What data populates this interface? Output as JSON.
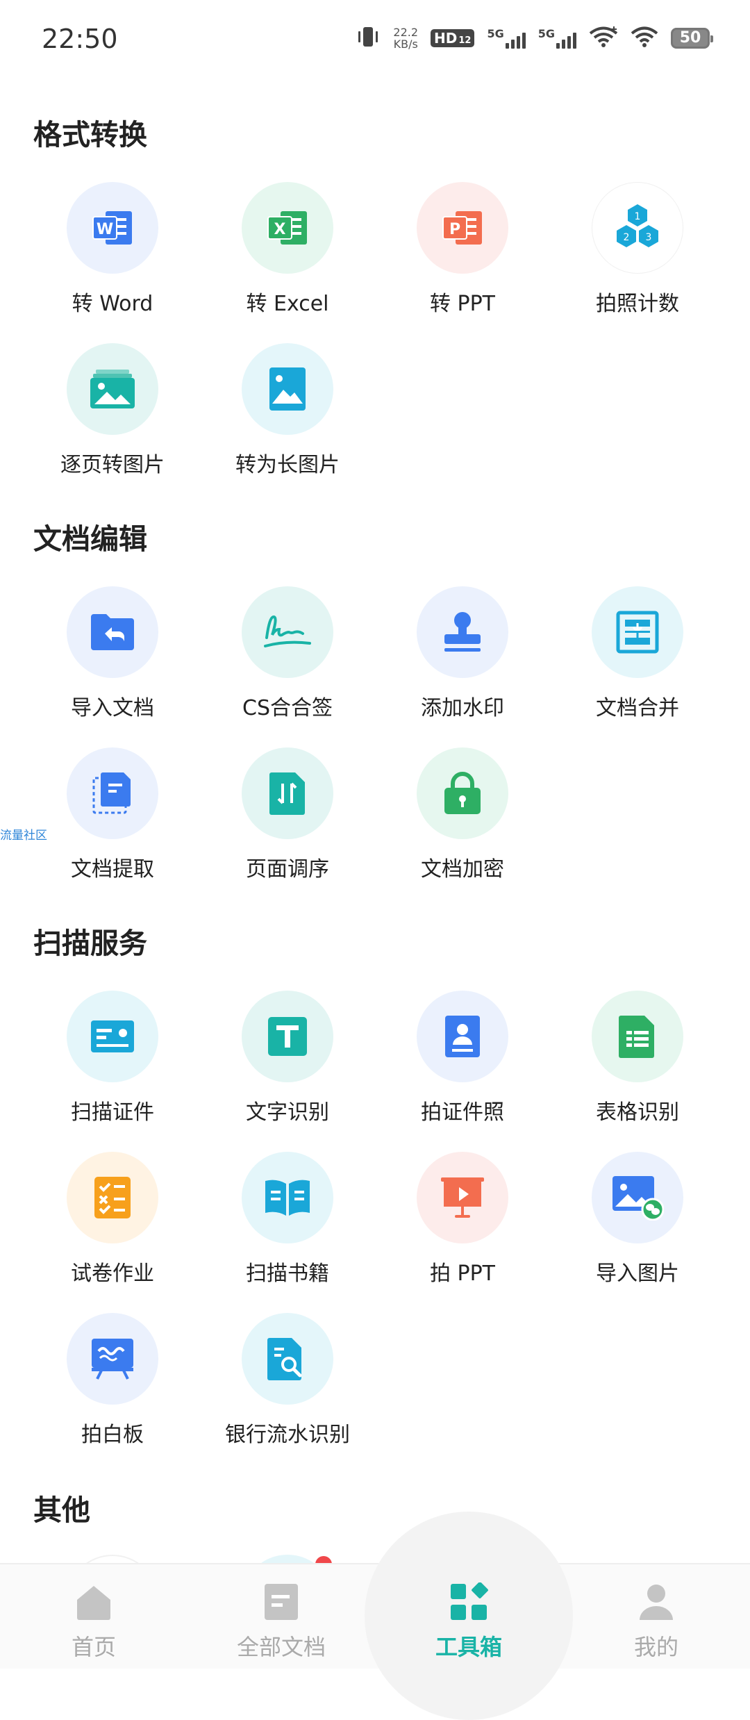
{
  "status_bar": {
    "time": "22:50",
    "net_speed_value": "22.2",
    "net_speed_unit": "KB/s",
    "hd_label": "HD",
    "hd_sub": "12",
    "sim1_label": "5G",
    "sim2_label": "5G",
    "battery": "50"
  },
  "sections": {
    "format_conversion": {
      "title": "格式转换",
      "items": [
        "转 Word",
        "转 Excel",
        "转 PPT",
        "拍照计数",
        "逐页转图片",
        "转为长图片"
      ]
    },
    "document_edit": {
      "title": "文档编辑",
      "items": [
        "导入文档",
        "CS合合签",
        "添加水印",
        "文档合并",
        "文档提取",
        "页面调序",
        "文档加密"
      ]
    },
    "scan_service": {
      "title": "扫描服务",
      "items": [
        "扫描证件",
        "文字识别",
        "拍证件照",
        "表格识别",
        "试卷作业",
        "扫描书籍",
        "拍 PPT",
        "导入图片",
        "拍白板",
        "银行流水识别"
      ]
    },
    "other": {
      "title": "其他"
    }
  },
  "side_float": "流量社区",
  "bottom_nav": {
    "items": [
      "首页",
      "全部文档",
      "工具箱",
      "我的"
    ],
    "active": "工具箱"
  },
  "colors": {
    "accent": "#19b3a6",
    "word_blue": "#3b7bef",
    "excel_green": "#2eaf64",
    "ppt_red": "#f36d4f"
  }
}
